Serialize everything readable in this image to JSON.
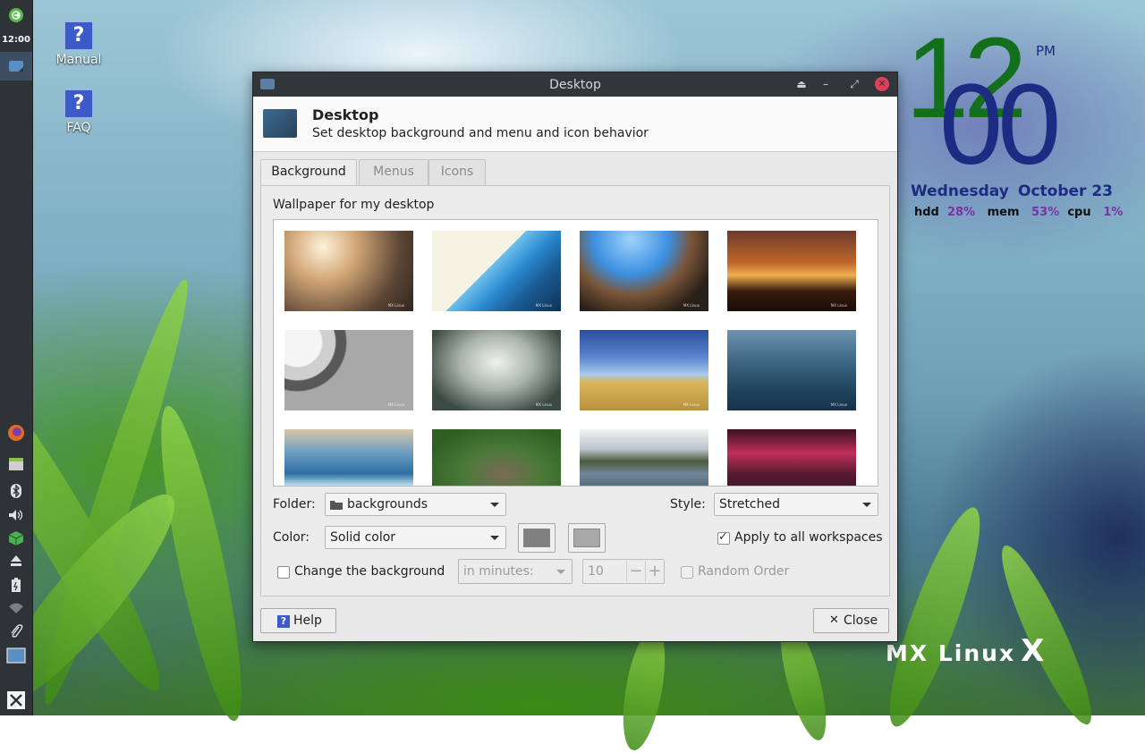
{
  "panel": {
    "clock": "12:00",
    "icons": [
      "power-icon",
      "window-list-icon",
      "firefox-icon",
      "file-manager-icon",
      "bluetooth-icon",
      "volume-icon",
      "package-updater-icon",
      "eject-icon",
      "battery-icon",
      "network-icon",
      "clipboard-icon",
      "workspace-icon",
      "mx-menu-icon"
    ]
  },
  "desktop_icons": [
    {
      "label": "Manual"
    },
    {
      "label": "FAQ"
    }
  ],
  "conky": {
    "hour": "12",
    "minute": "00",
    "ampm": "PM",
    "day": "Wednesday",
    "date": "October 23",
    "stats": {
      "hdd_label": "hdd",
      "hdd_value": "28%",
      "mem_label": "mem",
      "mem_value": "53%",
      "cpu_label": "cpu",
      "cpu_value": "1%"
    }
  },
  "logo": {
    "text": "MX Linux",
    "mark": "X"
  },
  "window": {
    "title": "Desktop",
    "header_title": "Desktop",
    "header_subtitle": "Set desktop background and menu and icon behavior",
    "tabs": [
      {
        "label": "Background",
        "active": true
      },
      {
        "label": "Menus",
        "active": false
      },
      {
        "label": "Icons",
        "active": false
      }
    ],
    "wallpaper_label": "Wallpaper for my desktop",
    "thumb_watermark": "MX Linux",
    "folder_label": "Folder:",
    "folder_value": "backgrounds",
    "style_label": "Style:",
    "style_value": "Stretched",
    "color_label": "Color:",
    "color_value": "Solid color",
    "color1": "#808080",
    "color2": "#a8a8a8",
    "apply_all_label": "Apply to all workspaces",
    "apply_all_checked": true,
    "change_bg_label": "Change the background",
    "change_bg_checked": false,
    "interval_value": "in minutes:",
    "minutes_value": "10",
    "random_label": "Random Order",
    "random_checked": false,
    "help_label": "Help",
    "close_label": "Close"
  }
}
